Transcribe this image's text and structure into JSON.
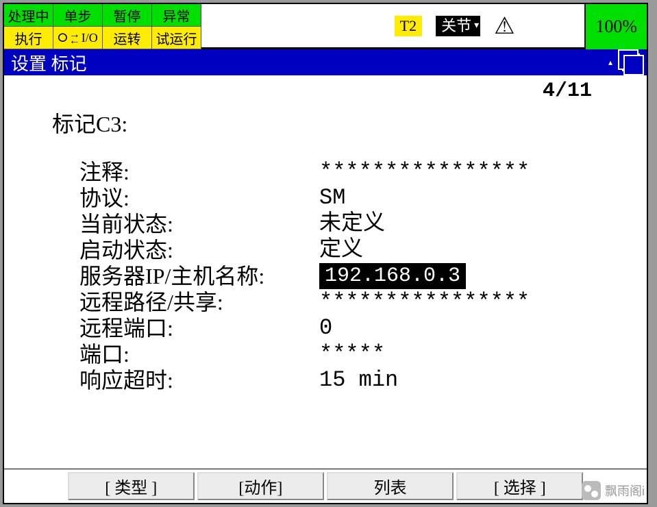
{
  "topbar": {
    "cells": {
      "r0c0": "处理中",
      "r0c1": "单步",
      "r0c2": "暂停",
      "r0c3": "异常",
      "r1c0": "执行",
      "r1c1": "I/O",
      "r1c2": "运转",
      "r1c3": "试运行"
    },
    "t2": "T2",
    "mode": "关节",
    "percent": "100%"
  },
  "titlebar": {
    "text": "设置 标记"
  },
  "content": {
    "pager": "4/11",
    "heading": "标记C3:",
    "rows": [
      {
        "label": "注释:",
        "value": "****************"
      },
      {
        "label": "协议:",
        "value": "SM"
      },
      {
        "label": "当前状态:",
        "value": "未定义"
      },
      {
        "label": "启动状态:",
        "value": "定义"
      },
      {
        "label": "服务器IP/主机名称:",
        "value": "192.168.0.3",
        "selected": true
      },
      {
        "label": "远程路径/共享:",
        "value": "****************"
      },
      {
        "label": "远程端口:",
        "value": "0"
      },
      {
        "label": "端口:",
        "value": "*****"
      },
      {
        "label": "响应超时:",
        "value": "15 min"
      }
    ]
  },
  "softkeys": {
    "k0": "[ 类型 ]",
    "k1": "[动作]",
    "k2": "列表",
    "k3": "[ 选择 ]"
  },
  "watermark": "飘雨阁i"
}
